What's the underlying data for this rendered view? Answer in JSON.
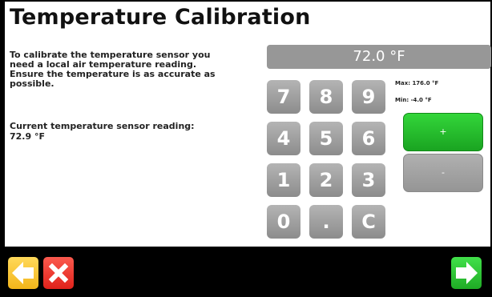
{
  "title": "Temperature Calibration",
  "instructions": "To calibrate the temperature sensor you\nneed a local air temperature reading.\nEnsure the temperature is as accurate as\npossible.",
  "current_reading": {
    "label": "Current temperature sensor reading:",
    "value": "72.9 °F"
  },
  "display_value": "72.0 °F",
  "keypad": {
    "keys": [
      "7",
      "8",
      "9",
      "4",
      "5",
      "6",
      "1",
      "2",
      "3",
      "0",
      ".",
      "C"
    ]
  },
  "limits": {
    "max": "Max: 176.0 °F",
    "min": "Min: -4.0 °F"
  },
  "buttons": {
    "plus": "+",
    "minus": "-"
  },
  "colors": {
    "accent_green": "#1fb224",
    "back_yellow": "#f5b91f",
    "cancel_red": "#e5271f"
  },
  "icons": {
    "back": "left-arrow-icon",
    "cancel": "close-icon",
    "next": "right-arrow-icon"
  }
}
